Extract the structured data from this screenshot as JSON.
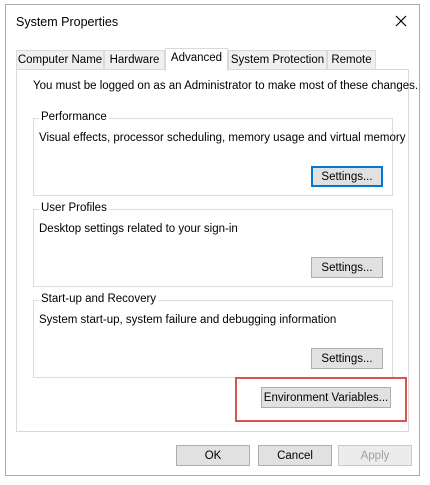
{
  "window": {
    "title": "System Properties"
  },
  "tabs": [
    {
      "label": "Computer Name"
    },
    {
      "label": "Hardware"
    },
    {
      "label": "Advanced",
      "active": true
    },
    {
      "label": "System Protection"
    },
    {
      "label": "Remote"
    }
  ],
  "advanced": {
    "intro": "You must be logged on as an Administrator to make most of these changes.",
    "performance": {
      "title": "Performance",
      "description": "Visual effects, processor scheduling, memory usage and virtual memory",
      "button": "Settings..."
    },
    "user_profiles": {
      "title": "User Profiles",
      "description": "Desktop settings related to your sign-in",
      "button": "Settings..."
    },
    "startup_recovery": {
      "title": "Start-up and Recovery",
      "description": "System start-up, system failure and debugging information",
      "button": "Settings..."
    },
    "environment_button": "Environment Variables..."
  },
  "footer": {
    "ok": "OK",
    "cancel": "Cancel",
    "apply": "Apply"
  },
  "colors": {
    "highlight": "#d9534f",
    "focus": "#0078d7"
  }
}
